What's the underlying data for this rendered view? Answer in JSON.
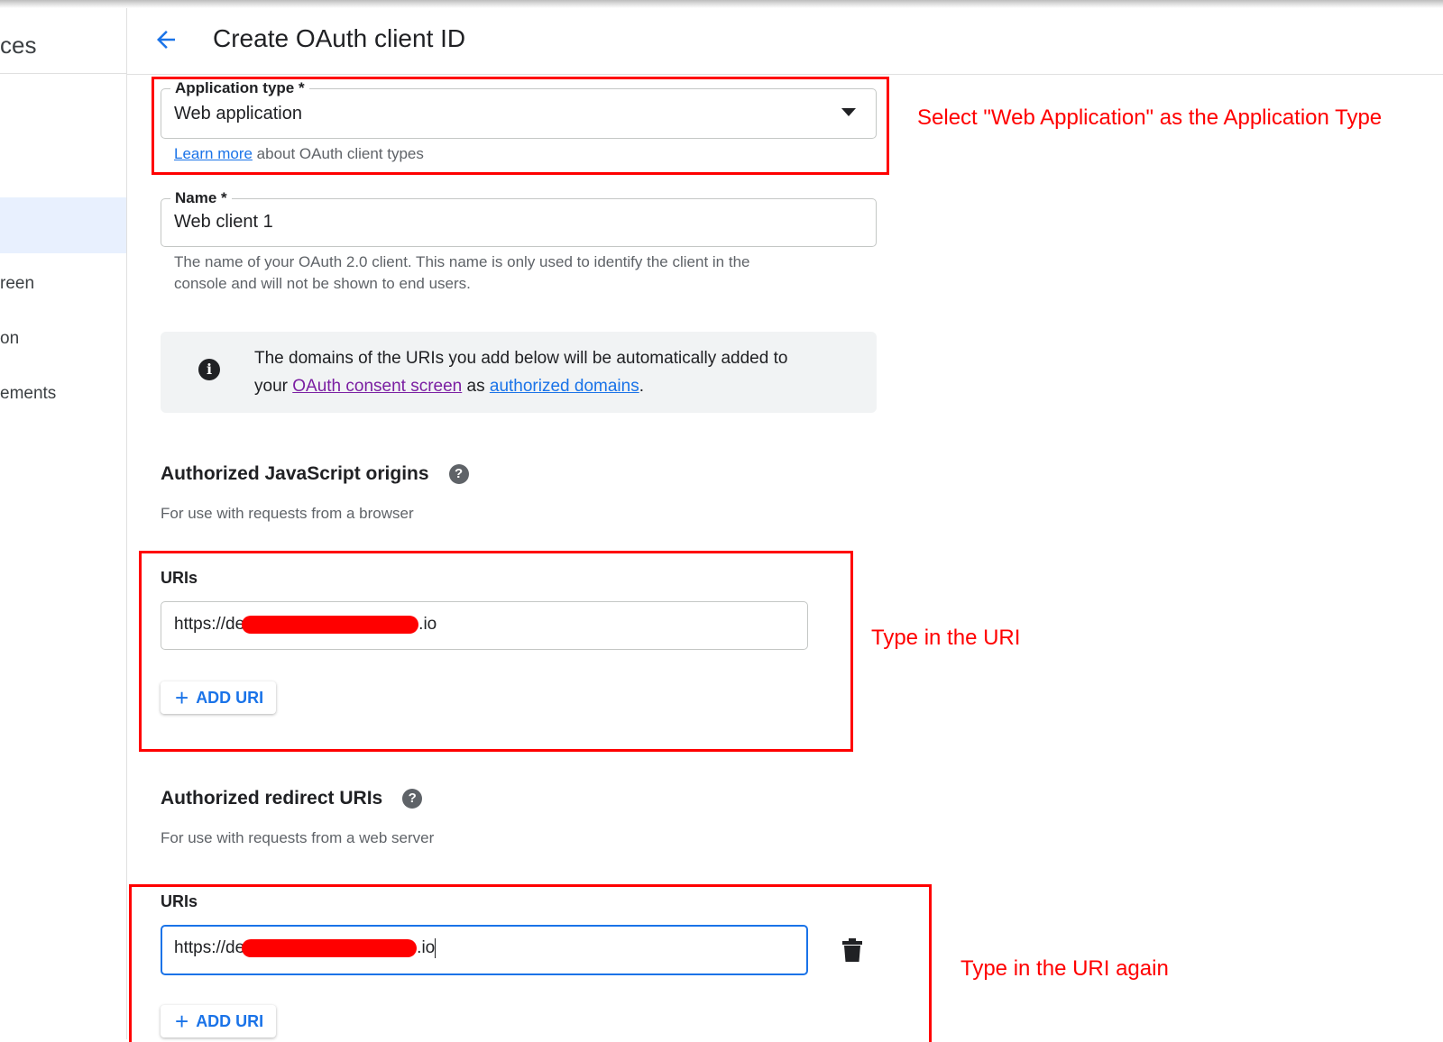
{
  "sidebar": {
    "title_fragment": "ces",
    "items": [
      {
        "label": "reen"
      },
      {
        "label": "on"
      },
      {
        "label": "ements"
      }
    ]
  },
  "header": {
    "title": "Create OAuth client ID",
    "back_icon": "arrow-back-icon"
  },
  "application_type": {
    "label": "Application type *",
    "value": "Web application",
    "learn_more_link": "Learn more",
    "learn_more_suffix": " about OAuth client types"
  },
  "name_field": {
    "label": "Name *",
    "value": "Web client 1",
    "helper_line1": "The name of your OAuth 2.0 client. This name is only used to identify the client in the",
    "helper_line2": "console and will not be shown to end users."
  },
  "info": {
    "icon": "info-icon",
    "text_part1": "The domains of the URIs you add below will be automatically added to",
    "text_part2": "your ",
    "consent_link": "OAuth consent screen",
    "text_part3": " as ",
    "domains_link": "authorized domains",
    "text_part4": "."
  },
  "js_origins": {
    "title": "Authorized JavaScript origins",
    "subtitle": "For use with requests from a browser",
    "uris_label": "URIs",
    "uri_prefix": "https://de",
    "uri_suffix": ".io",
    "add_button": "ADD URI"
  },
  "redirect_uris": {
    "title": "Authorized redirect URIs",
    "subtitle": "For use with requests from a web server",
    "uris_label": "URIs",
    "uri_prefix": "https://de",
    "uri_suffix": ".io",
    "add_button": "ADD URI"
  },
  "annotations": {
    "app_type": "Select \"Web Application\" as the Application Type",
    "type_uri": "Type in the URI",
    "type_uri_again": "Type in the URI again"
  },
  "colors": {
    "accent": "#1a73e8",
    "annotation": "#ff0000",
    "visited_link": "#7b1fa2"
  }
}
